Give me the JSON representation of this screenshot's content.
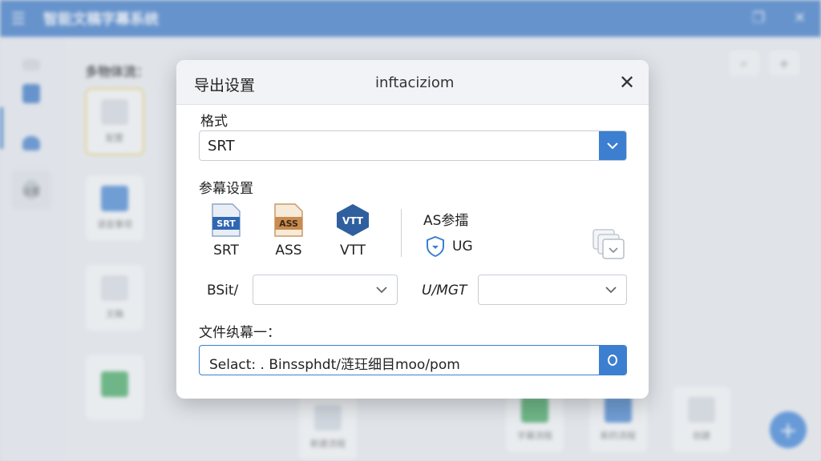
{
  "app": {
    "title": "智能文稿字幕系统",
    "main_heading": "多物体流：",
    "sidebar_items": [
      "",
      "",
      "设置"
    ],
    "cards": [
      "配置",
      "语音事项",
      "文稿",
      "",
      "新建流程",
      "字幕流程",
      "新的流程",
      "创建"
    ]
  },
  "dialog": {
    "title": "导出设置",
    "subtitle": "inftaciziom",
    "format": {
      "label": "格式",
      "selected": "SRT"
    },
    "subtitle_settings": {
      "label": "参幕设置",
      "formats": [
        {
          "name": "SRT",
          "badge": "SRT",
          "color": "#2f67b2"
        },
        {
          "name": "ASS",
          "badge": "ASS",
          "color": "#c98b50"
        },
        {
          "name": "VTT",
          "badge": "VTT",
          "color": "#2f5f9e"
        }
      ],
      "as_label": "AS参擂",
      "ug_label": "UG"
    },
    "bsit": {
      "label": "BSit/",
      "value": ""
    },
    "umgt": {
      "label": "U/MGT",
      "value": ""
    },
    "file": {
      "label": "文件纨幕一：",
      "path": "Selact: . Binssphdt/涟玨细目moo/pom"
    }
  },
  "colors": {
    "accent": "#3c7fd0",
    "titlebar": "#2e6fc4"
  }
}
